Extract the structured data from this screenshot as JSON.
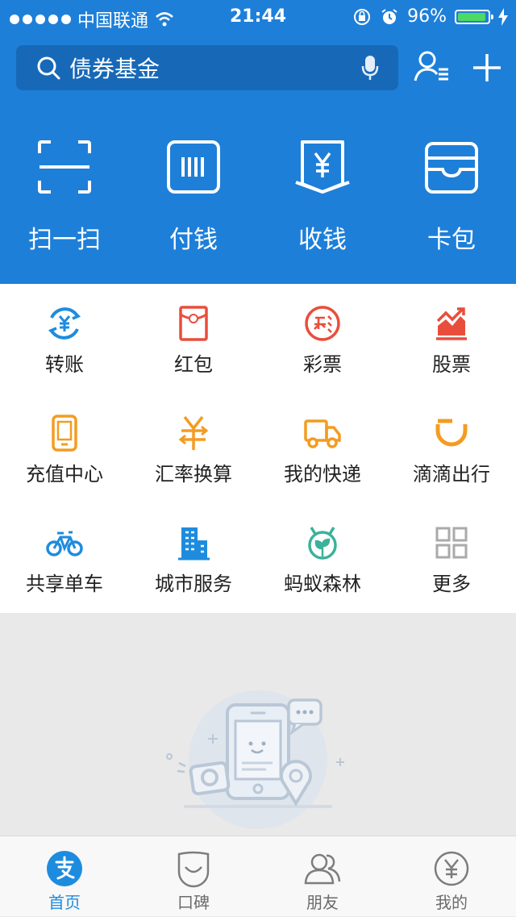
{
  "status_bar": {
    "carrier": "中国联通",
    "time": "21:44",
    "battery_percent": "96%",
    "battery_level": 0.96
  },
  "search": {
    "placeholder": "债券基金"
  },
  "quick_actions": [
    {
      "label": "扫一扫",
      "icon": "scan-icon"
    },
    {
      "label": "付钱",
      "icon": "barcode-icon"
    },
    {
      "label": "收钱",
      "icon": "receive-money-icon"
    },
    {
      "label": "卡包",
      "icon": "card-wallet-icon"
    }
  ],
  "grid": [
    {
      "label": "转账",
      "icon": "transfer-icon",
      "color": "#1e8cde"
    },
    {
      "label": "红包",
      "icon": "red-envelope-icon",
      "color": "#e94e3c"
    },
    {
      "label": "彩票",
      "icon": "lottery-icon",
      "color": "#e94e3c"
    },
    {
      "label": "股票",
      "icon": "stocks-icon",
      "color": "#e94e3c"
    },
    {
      "label": "充值中心",
      "icon": "mobile-topup-icon",
      "color": "#f39c22"
    },
    {
      "label": "汇率换算",
      "icon": "exchange-rate-icon",
      "color": "#f39c22"
    },
    {
      "label": "我的快递",
      "icon": "delivery-truck-icon",
      "color": "#f39c22"
    },
    {
      "label": "滴滴出行",
      "icon": "didi-icon",
      "color": "#f39c22"
    },
    {
      "label": "共享单车",
      "icon": "bicycle-icon",
      "color": "#1e8cde"
    },
    {
      "label": "城市服务",
      "icon": "city-building-icon",
      "color": "#1e8cde"
    },
    {
      "label": "蚂蚁森林",
      "icon": "ant-forest-icon",
      "color": "#3bb29b"
    },
    {
      "label": "更多",
      "icon": "more-grid-icon",
      "color": "#aaaaaa"
    }
  ],
  "tabs": [
    {
      "label": "首页",
      "icon": "alipay-home-icon",
      "active": true
    },
    {
      "label": "口碑",
      "icon": "koubei-icon",
      "active": false
    },
    {
      "label": "朋友",
      "icon": "friends-icon",
      "active": false
    },
    {
      "label": "我的",
      "icon": "my-account-icon",
      "active": false
    }
  ],
  "colors": {
    "brand_blue": "#1e7fd9",
    "tab_active": "#1e8cde"
  }
}
